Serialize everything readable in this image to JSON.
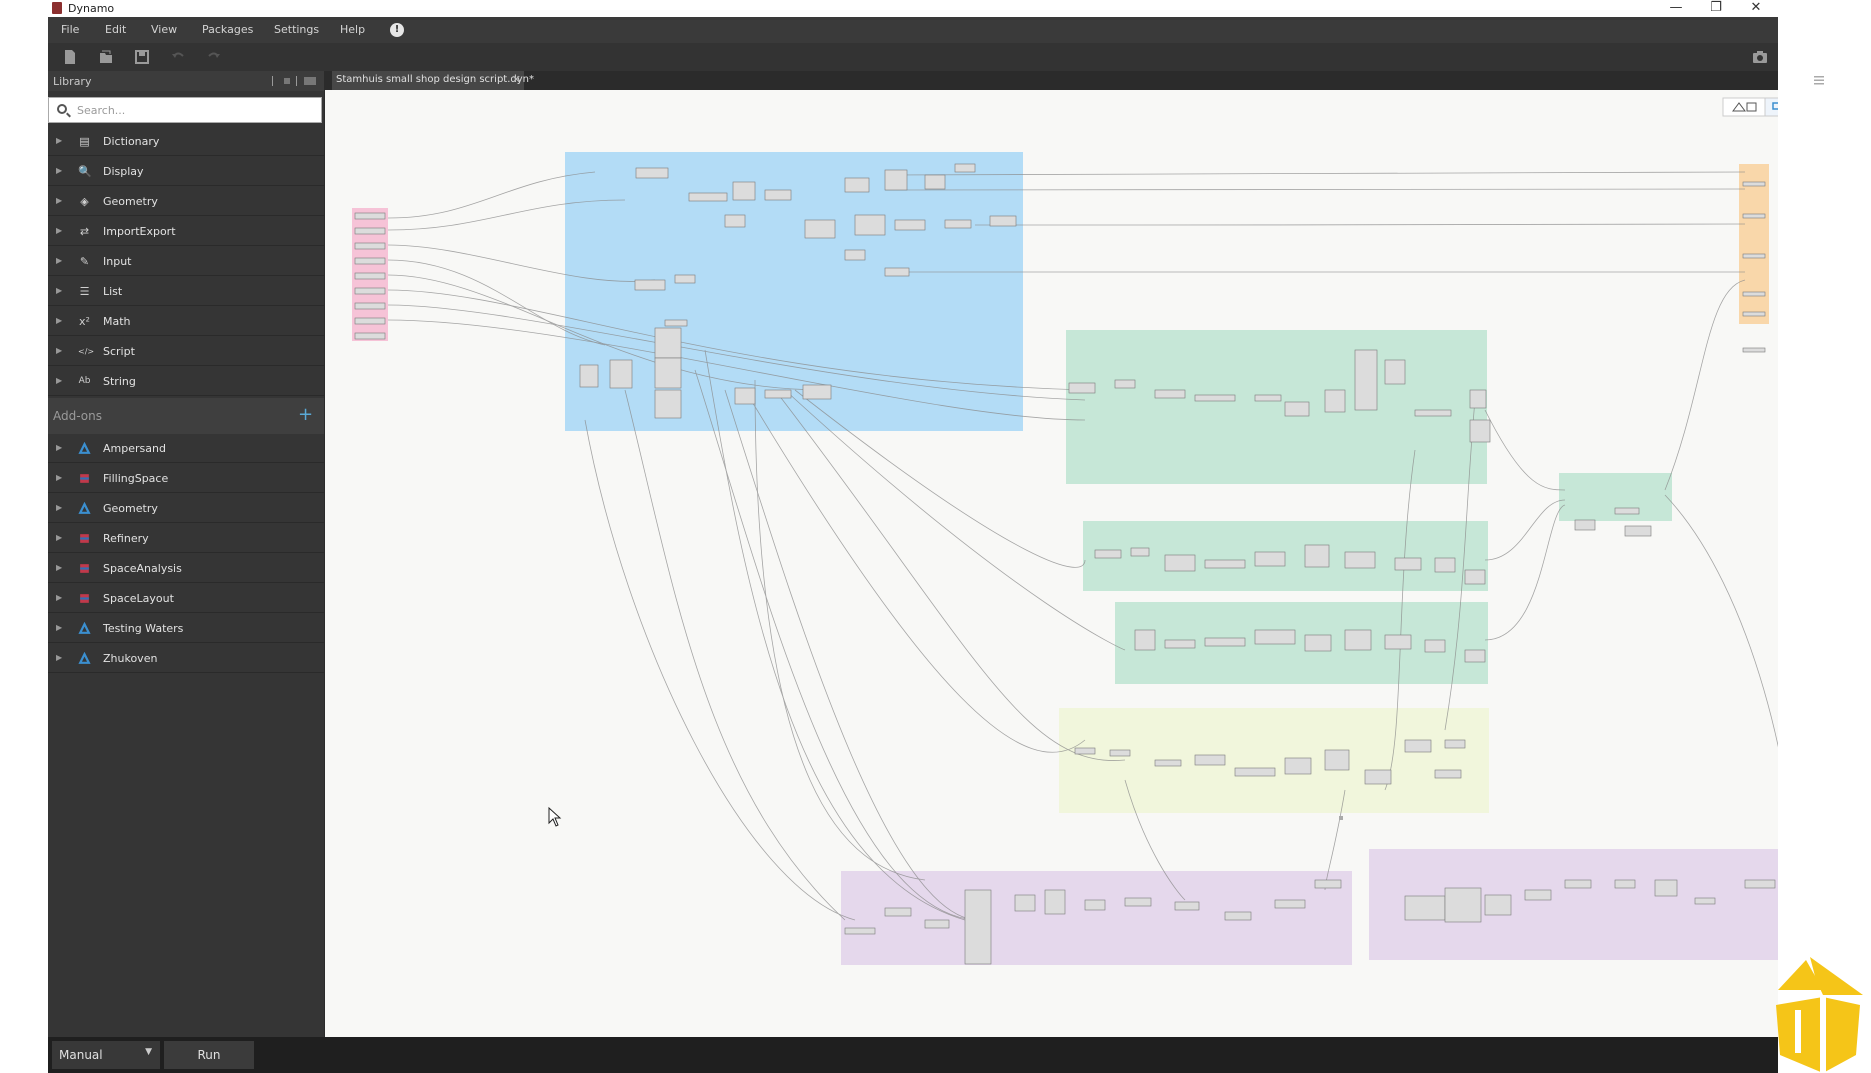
{
  "window": {
    "title": "Dynamo",
    "controls": [
      "—",
      "❐",
      "✕"
    ]
  },
  "menu": [
    "File",
    "Edit",
    "View",
    "Packages",
    "Settings",
    "Help"
  ],
  "menu_info_glyph": "!",
  "library": {
    "header": "Library",
    "search_placeholder": "Search...",
    "items": [
      {
        "label": "Dictionary",
        "icon": "dictionary-icon",
        "glyph": "▤"
      },
      {
        "label": "Display",
        "icon": "magnifier-icon",
        "glyph": "🔍"
      },
      {
        "label": "Geometry",
        "icon": "cube-icon",
        "glyph": "◈"
      },
      {
        "label": "ImportExport",
        "icon": "transfer-icon",
        "glyph": "⇄"
      },
      {
        "label": "Input",
        "icon": "pencil-icon",
        "glyph": "✎"
      },
      {
        "label": "List",
        "icon": "list-icon",
        "glyph": "☰"
      },
      {
        "label": "Math",
        "icon": "math-icon",
        "glyph": "x²"
      },
      {
        "label": "Script",
        "icon": "code-icon",
        "glyph": "</>"
      },
      {
        "label": "String",
        "icon": "text-icon",
        "glyph": "Ab"
      }
    ],
    "addons_header": "Add-ons",
    "addons_plus": "+",
    "addons": [
      {
        "label": "Ampersand",
        "icon": "package-blue-icon",
        "color": "#3b8fd0"
      },
      {
        "label": "FillingSpace",
        "icon": "package-red-icon",
        "color": "#c0394b"
      },
      {
        "label": "Geometry",
        "icon": "package-blue-icon",
        "color": "#3b8fd0"
      },
      {
        "label": "Refinery",
        "icon": "package-red-icon",
        "color": "#c0394b"
      },
      {
        "label": "SpaceAnalysis",
        "icon": "package-red-icon",
        "color": "#c0394b"
      },
      {
        "label": "SpaceLayout",
        "icon": "package-red-icon",
        "color": "#c0394b"
      },
      {
        "label": "Testing Waters",
        "icon": "package-blue-icon",
        "color": "#3b8fd0"
      },
      {
        "label": "Zhukoven",
        "icon": "package-blue-icon",
        "color": "#3b8fd0"
      }
    ]
  },
  "tab": {
    "label": "Stamhuis small shop design script.dyn*",
    "close": "✕"
  },
  "run": {
    "mode": "Manual",
    "button": "Run"
  },
  "colors": {
    "group_blue": "#b3dcf6",
    "group_pink": "#f6c3d7",
    "group_green": "#c6e7d7",
    "group_yellow": "#f1f6dc",
    "group_purple": "#e5d8ec",
    "group_orange": "#f9d7aa",
    "canvas_bg": "#f8f8f6",
    "logo_yellow": "#f5c518"
  }
}
